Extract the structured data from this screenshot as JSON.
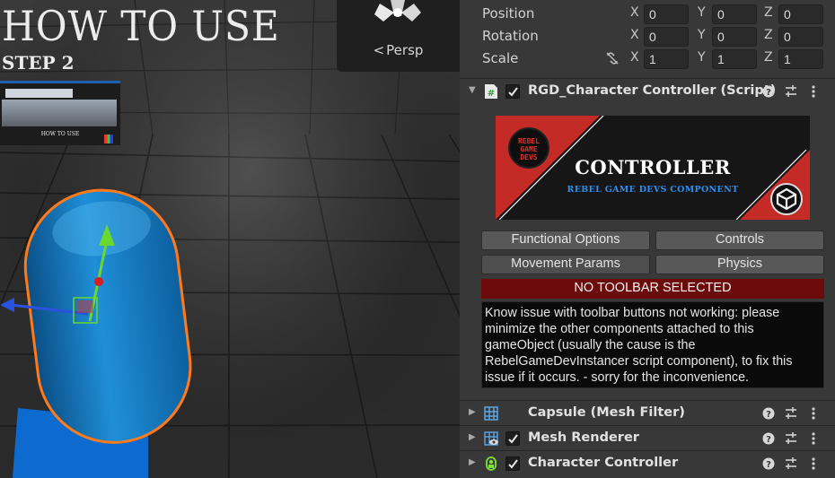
{
  "scene": {
    "title": "HOW TO USE",
    "step": "STEP 2",
    "mini_caption": "HOW TO USE",
    "camera_mode": "Persp"
  },
  "transform": {
    "rows": [
      {
        "label": "Position",
        "x": "0",
        "y": "0",
        "z": "0"
      },
      {
        "label": "Rotation",
        "x": "0",
        "y": "0",
        "z": "0"
      },
      {
        "label": "Scale",
        "x": "1",
        "y": "1",
        "z": "1"
      }
    ],
    "axis_labels": {
      "x": "X",
      "y": "Y",
      "z": "Z"
    }
  },
  "script_component": {
    "title": "RGD_Character Controller (Script)",
    "banner_title": "CONTROLLER",
    "banner_subtitle": "REBEL GAME DEVS COMPONENT",
    "banner_logo_lines": [
      "REBEL",
      "GAME",
      "DEVS"
    ],
    "toolbar_buttons": [
      "Functional Options",
      "Controls",
      "Movement Params",
      "Physics"
    ],
    "notice": "NO TOOLBAR SELECTED",
    "help_text": "Know issue with toolbar buttons not working: please minimize the other components attached to this gameObject (usually the cause is the RebelGameDevInstancer script component), to fix this issue if it occurs. - sorry for the inconvenience."
  },
  "components": [
    {
      "title": "Capsule (Mesh Filter)",
      "icon": "mesh-filter-icon",
      "has_checkbox": false
    },
    {
      "title": "Mesh Renderer",
      "icon": "mesh-renderer-icon",
      "has_checkbox": true
    },
    {
      "title": "Character Controller",
      "icon": "character-controller-icon",
      "has_checkbox": true
    }
  ],
  "colors": {
    "banner_red": "#c42b27",
    "notice_red": "#6c0b0b",
    "selection_orange": "#ff7a1a",
    "capsule_blue": "#1e8fd6"
  }
}
